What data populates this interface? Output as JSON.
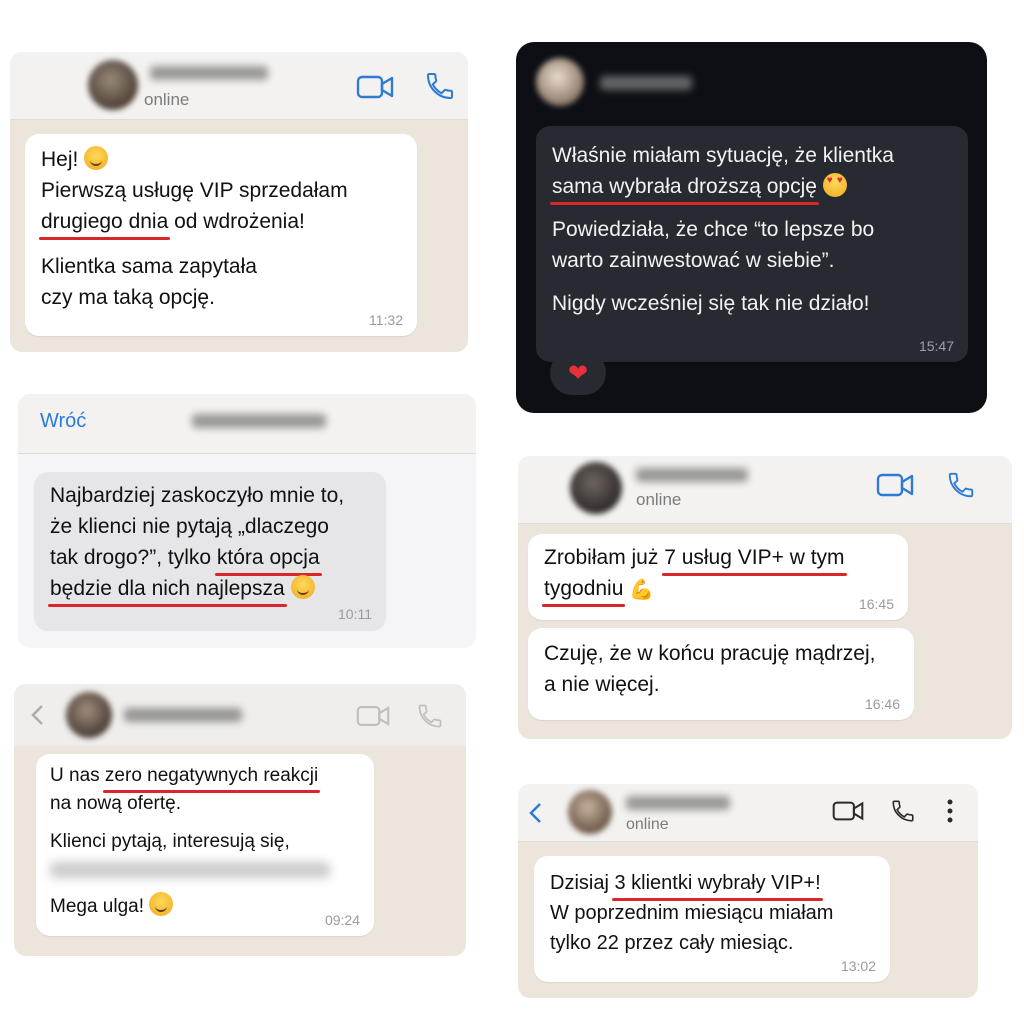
{
  "chat1": {
    "status": "online",
    "lines": [
      "Hej!",
      "Pierwszą usługę VIP sprzedałam",
      "drugiego dnia",
      " od wdrożenia!",
      "Klientka sama zapytała",
      "czy ma taką opcję."
    ],
    "time": "11:32"
  },
  "chat2": {
    "lines": [
      "Właśnie miałam sytuację, że klientka",
      "sama wybrała droższą opcję",
      "Powiedziała, że chce “to lepsze bo",
      "warto zainwestować w siebie”.",
      "Nigdy wcześniej się tak nie działo!"
    ],
    "time": "15:47",
    "reaction": "❤"
  },
  "chat3": {
    "back_label": "Wróć",
    "lines": [
      "Najbardziej zaskoczyło mnie to,",
      "że klienci nie pytają „dlaczego",
      "tak drogo?”, tylko ",
      "która opcja",
      "będzie dla nich najlepsza"
    ],
    "time": "10:11"
  },
  "chat4": {
    "status": "online",
    "msg1": [
      "Zrobiłam już ",
      "7 usług VIP+ w tym",
      "tygodniu"
    ],
    "time1": "16:45",
    "msg2": [
      "Czuję, że w końcu pracuję mądrzej,",
      "a nie więcej."
    ],
    "time2": "16:46"
  },
  "chat5": {
    "lines": [
      "U nas ",
      "zero negatywnych reakcji",
      "na nową ofertę.",
      "Klienci pytają, interesują się,",
      "Mega ulga!"
    ],
    "time": "09:24"
  },
  "chat6": {
    "status": "online",
    "lines": [
      "Dzisiaj ",
      "3 klientki wybrały VIP+!",
      "W poprzednim miesiącu miałam",
      "tylko 22 przez cały miesiąc."
    ],
    "time": "13:02"
  },
  "colors": {
    "underline": "#d9262b",
    "accent_blue": "#2e7bd6",
    "chat_bg": "#ece5dc",
    "dark_bg": "#0d0f14"
  },
  "icons": [
    "video-icon",
    "phone-icon",
    "back-chevron-icon",
    "more-icon"
  ]
}
